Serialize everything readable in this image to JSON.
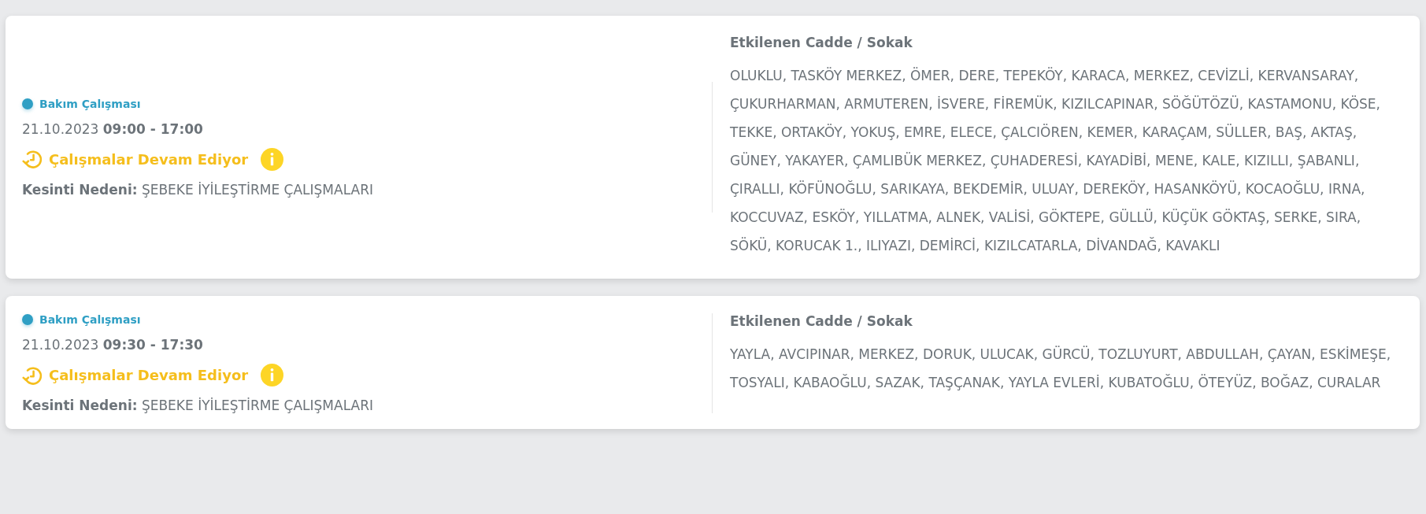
{
  "outages": [
    {
      "type": "Bakım Çalışması",
      "datetime": "21.10.2023 **09:00 - 17:00**",
      "status": "Çalışmalar Devam Ediyor",
      "reason": "**Kesinti Nedeni:** ŞEBEKE İYİLEŞTİRME ÇALIŞMALARI",
      "streets_title": "Etkilenen Cadde / Sokak",
      "streets": "OLUKLU, TASKÖY MERKEZ, ÖMER, DERE, TEPEKÖY, KARACA, MERKEZ, CEVİZLİ, KERVANSARAY, ÇUKURHARMAN, ARMUTEREN, İSVERE, FİREMÜK, KIZILCAPINAR, SÖĞÜTÖZÜ, KASTAMONU, KÖSE, TEKKE, ORTAKÖY, YOKUŞ, EMRE, ELECE, ÇALCIÖREN, KEMER, KARAÇAM, SÜLLER, BAŞ, AKTAŞ, GÜNEY, YAKAYER, ÇAMLIBÜK MERKEZ, ÇUHADERESİ, KAYADİBİ, MENE, KALE, KIZILLI, ŞABANLI, ÇIRALLI, KÖFÜNOĞLU, SARIKAYA, BEKDEMİR, ULUAY, DEREKÖY, HASANKÖYÜ, KOCAOĞLU, IRNA, KOCCUVAZ, ESKÖY, YILLATMA, ALNEK, VALİSİ, GÖKTEPE, GÜLLÜ, KÜÇÜK GÖKTAŞ, SERKE, SIRA, SÖKÜ, KORUCAK 1., ILIYAZI, DEMİRCİ, KIZILCATARLA, DİVANDAĞ, KAVAKLI"
    },
    {
      "type": "Bakım Çalışması",
      "datetime": "21.10.2023 **09:30 - 17:30**",
      "status": "Çalışmalar Devam Ediyor",
      "reason": "**Kesinti Nedeni:** ŞEBEKE İYİLEŞTİRME ÇALIŞMALARI",
      "streets_title": "Etkilenen Cadde / Sokak",
      "streets": "YAYLA, AVCIPINAR, MERKEZ, DORUK, ULUCAK, GÜRCÜ, TOZLUYURT, ABDULLAH, ÇAYAN, ESKİMEŞE, TOSYALI, KABAOĞLU, SAZAK, TAŞÇANAK, YAYLA EVLERİ, KUBATOĞLU, ÖTEYÜZ, BOĞAZ, CURALAR"
    }
  ]
}
